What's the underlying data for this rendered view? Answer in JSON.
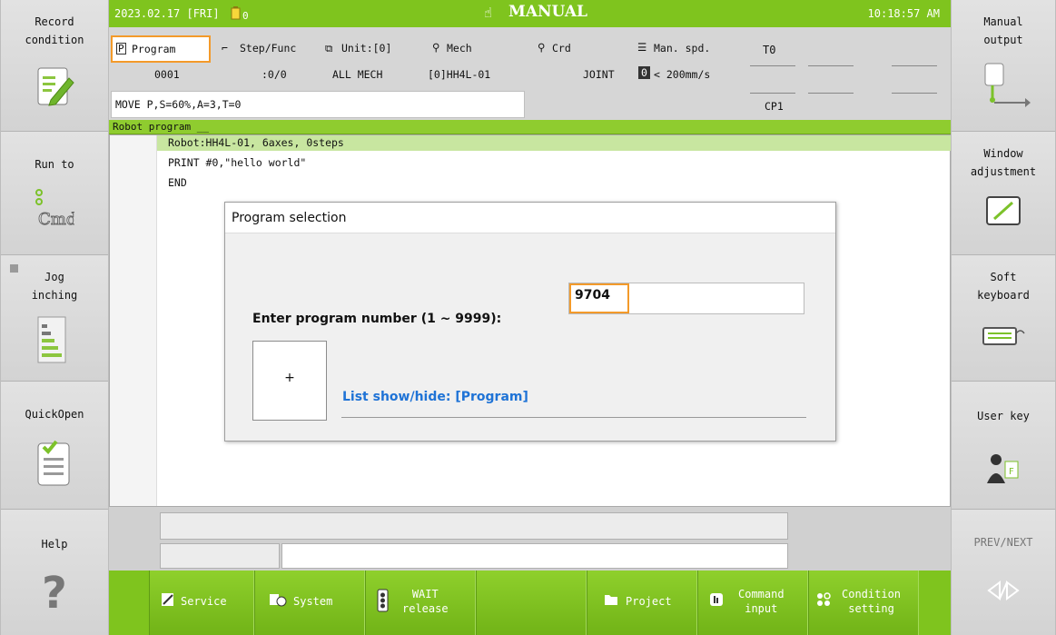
{
  "header": {
    "date": "2023.02.17 [FRI]",
    "mode": "MANUAL",
    "time": "10:18:57 AM",
    "battery": "0"
  },
  "info": {
    "program": {
      "label": "Program",
      "value": "0001"
    },
    "step": {
      "label": "Step/Func",
      "value": ":0/0"
    },
    "unit": {
      "label": "Unit:[0]",
      "value": "ALL MECH"
    },
    "mech": {
      "label": "Mech",
      "value": "[0]HH4L-01"
    },
    "crd": {
      "label": "Crd",
      "value": "JOINT"
    },
    "speed": {
      "label": "Man. spd.",
      "value": "< 200mm/s",
      "level": "0"
    },
    "to": "T0",
    "cp": "CP1",
    "command": "MOVE P,S=60%,A=3,T=0"
  },
  "program_area": {
    "title": "Robot program __",
    "lines": [
      "Robot:HH4L-01, 6axes, 0steps",
      "PRINT #0,\"hello world\"",
      "END"
    ]
  },
  "dialog": {
    "title": "Program selection",
    "prompt": "Enter program number (1 ~ 9999):",
    "value": "9704",
    "plus": "+",
    "list_toggle": "List show/hide: [Program]"
  },
  "left_panel": [
    {
      "label": "Record\ncondition",
      "icon": "pencil-icon"
    },
    {
      "label": "Run to",
      "icon": "cmd-icon"
    },
    {
      "label": "Jog\ninching",
      "icon": "jog-icon"
    },
    {
      "label": "QuickOpen",
      "icon": "checklist-icon"
    },
    {
      "label": "Help",
      "icon": "help-icon"
    }
  ],
  "right_panel": [
    {
      "label": "Manual\noutput",
      "icon": "output-icon"
    },
    {
      "label": "Window\nadjustment",
      "icon": "window-icon"
    },
    {
      "label": "Soft\nkeyboard",
      "icon": "keyboard-icon"
    },
    {
      "label": "User key",
      "icon": "user-key-icon"
    },
    {
      "label": "PREV/NEXT",
      "icon": "prev-next-icon"
    }
  ],
  "footer": [
    {
      "label": "Service",
      "icon": "service-icon"
    },
    {
      "label": "System",
      "icon": "system-icon"
    },
    {
      "label": "WAIT\nrelease",
      "icon": "traffic-light-icon"
    },
    {
      "label": "",
      "icon": ""
    },
    {
      "label": "Project",
      "icon": "folder-icon"
    },
    {
      "label": "Command\ninput",
      "icon": "hand-icon"
    },
    {
      "label": "Condition\nsetting",
      "icon": "condition-icon"
    }
  ],
  "colors": {
    "accent": "#7fc41e",
    "highlight": "#f39a2a",
    "link": "#1f73d6"
  }
}
